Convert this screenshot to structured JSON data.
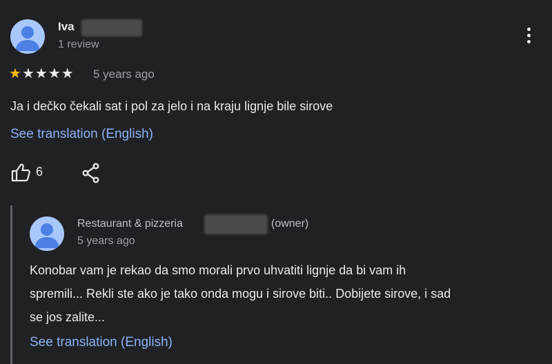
{
  "review": {
    "reviewer_name": "Iva",
    "reviewer_meta": "1 review",
    "rating": 1,
    "max_rating": 5,
    "time": "5 years ago",
    "text": "Ja i dečko čekali sat i pol za jelo i na kraju lignje bile sirove",
    "translate_label": "See translation (English)",
    "like_count": "6",
    "icons": {
      "avatar": "person-icon",
      "more": "more-vert-icon",
      "like": "thumb-up-icon",
      "share": "share-icon"
    }
  },
  "owner_reply": {
    "name": "Restaurant & pizzeria",
    "role": "(owner)",
    "time": "5 years ago",
    "text_lines": [
      "Konobar vam je rekao da smo morali prvo uhvatiti lignje da bi vam ih",
      "spremili... Rekli ste ako je tako onda mogu i sirove biti.. Dobijete sirove, i sad",
      "se jos zalite..."
    ],
    "translate_label": "See translation (English)"
  },
  "colors": {
    "background": "#202124",
    "star_on": "#fbbc04",
    "link": "#8ab4f8",
    "avatar": "#a8c7fa"
  }
}
